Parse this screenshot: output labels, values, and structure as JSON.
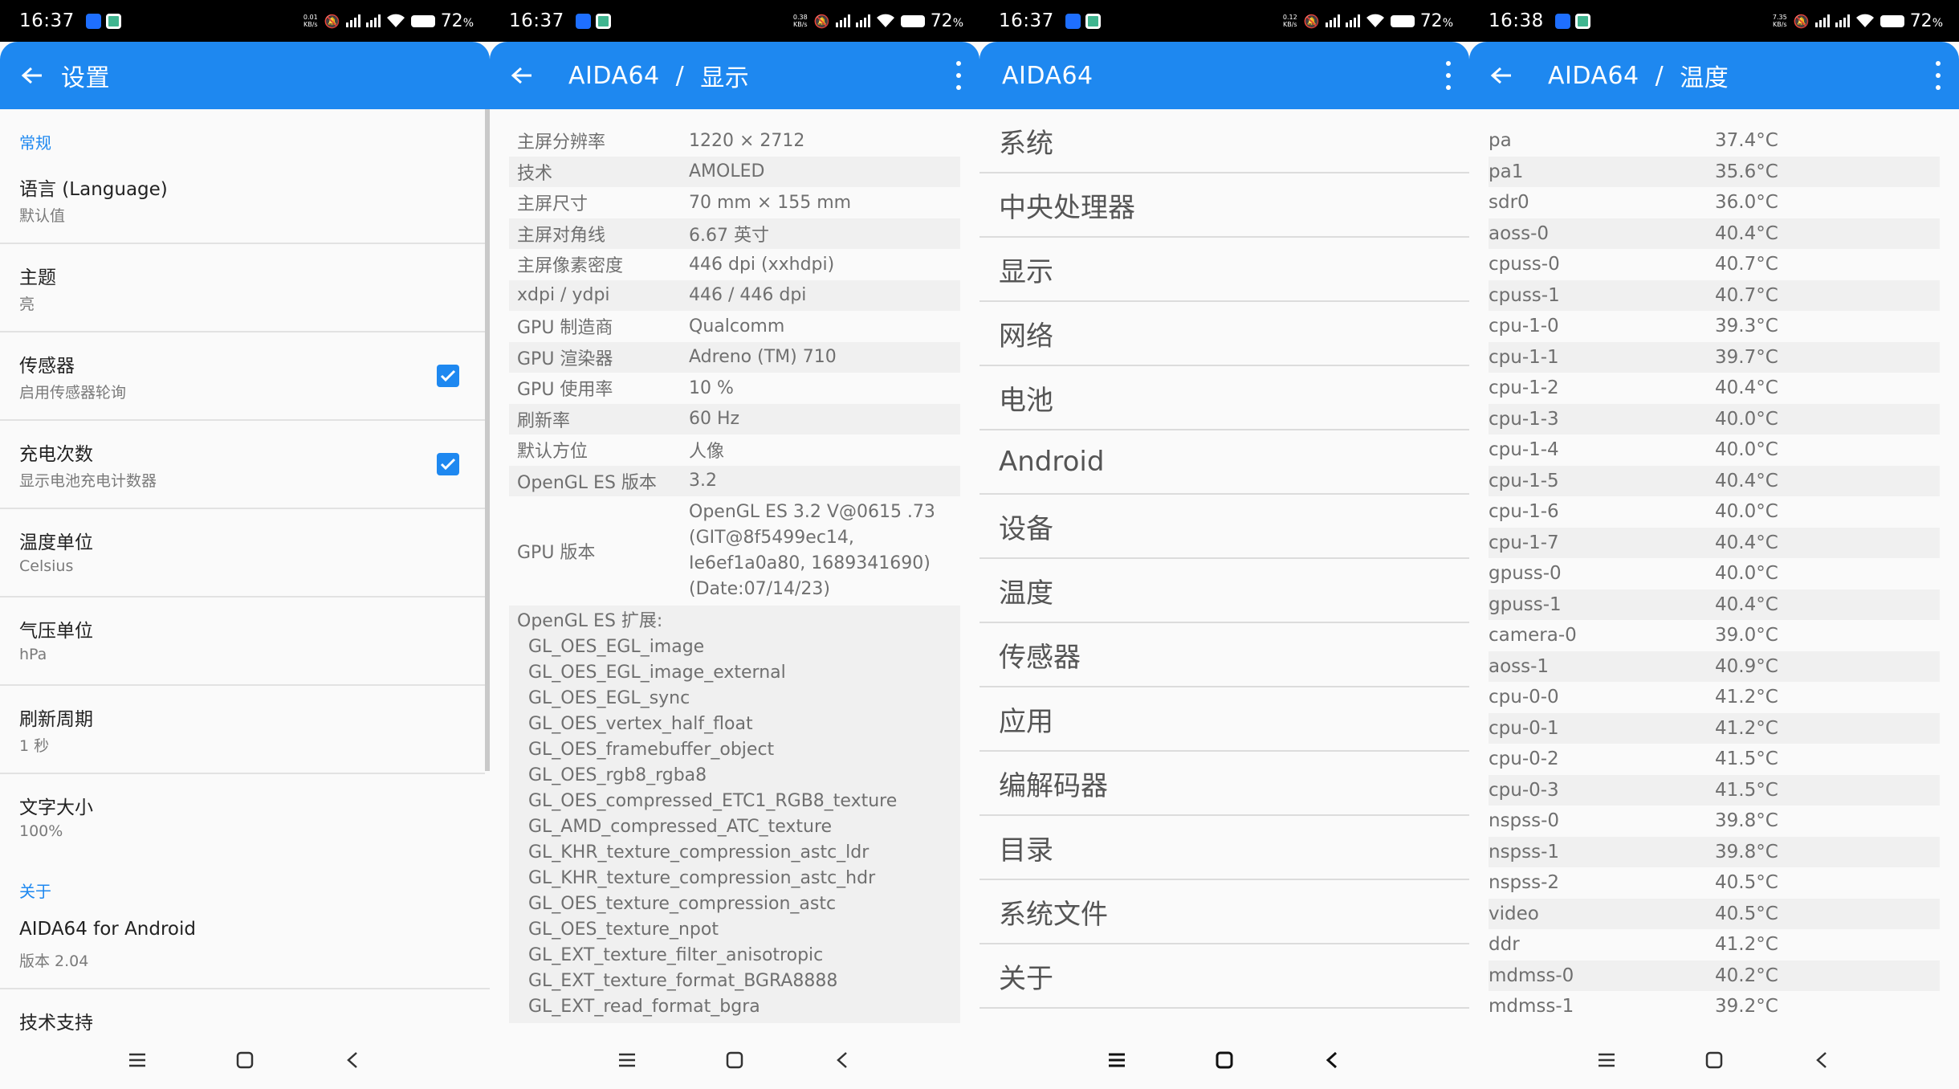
{
  "status_bars": [
    {
      "time": "16:37",
      "speed_top": "0.01",
      "speed_unit": "KB/s",
      "battery": "72"
    },
    {
      "time": "16:37",
      "speed_top": "0.38",
      "speed_unit": "KB/s",
      "battery": "72"
    },
    {
      "time": "16:37",
      "speed_top": "0.12",
      "speed_unit": "KB/s",
      "battery": "72"
    },
    {
      "time": "16:38",
      "speed_top": "7.35",
      "speed_unit": "KB/s",
      "battery": "72"
    }
  ],
  "battery_suffix": "%",
  "settings": {
    "title": "设置",
    "section_general": "常规",
    "items": [
      {
        "title": "语言 (Language)",
        "subtitle": "默认值"
      },
      {
        "title": "主题",
        "subtitle": "亮"
      },
      {
        "title": "传感器",
        "subtitle": "启用传感器轮询",
        "checked": true
      },
      {
        "title": "充电次数",
        "subtitle": "显示电池充电计数器",
        "checked": true
      },
      {
        "title": "温度单位",
        "subtitle": "Celsius"
      },
      {
        "title": "气压单位",
        "subtitle": "hPa"
      },
      {
        "title": "刷新周期",
        "subtitle": "1 秒"
      },
      {
        "title": "文字大小",
        "subtitle": "100%"
      }
    ],
    "section_about": "关于",
    "about_items": [
      {
        "title": "AIDA64 for Android",
        "subtitle": "版本 2.04"
      },
      {
        "title": "技术支持",
        "subtitle": ""
      }
    ]
  },
  "display": {
    "app_name": "AIDA64",
    "separator": "/",
    "page": "显示",
    "rows": [
      {
        "k": "主屏分辨率",
        "v": "1220 × 2712"
      },
      {
        "k": "技术",
        "v": "AMOLED"
      },
      {
        "k": "主屏尺寸",
        "v": "70 mm × 155 mm"
      },
      {
        "k": "主屏对角线",
        "v": "6.67 英寸"
      },
      {
        "k": "主屏像素密度",
        "v": "446 dpi (xxhdpi)"
      },
      {
        "k": "xdpi / ydpi",
        "v": "446 / 446 dpi"
      },
      {
        "k": "GPU 制造商",
        "v": "Qualcomm"
      },
      {
        "k": "GPU 渲染器",
        "v": "Adreno (TM) 710"
      },
      {
        "k": "GPU 使用率",
        "v": "10 %"
      },
      {
        "k": "刷新率",
        "v": "60 Hz"
      },
      {
        "k": "默认方位",
        "v": "人像"
      },
      {
        "k": "OpenGL ES 版本",
        "v": "3.2"
      }
    ],
    "gpu_version_label": "GPU 版本",
    "gpu_version_value": "OpenGL ES 3.2 V@0615 .73 (GIT@8f5499ec14, Ie6ef1a0a80, 1689341690) (Date:07/14/23)",
    "ext_label": "OpenGL ES 扩展:",
    "extensions": [
      "GL_OES_EGL_image",
      "GL_OES_EGL_image_external",
      "GL_OES_EGL_sync",
      "GL_OES_vertex_half_float",
      "GL_OES_framebuffer_object",
      "GL_OES_rgb8_rgba8",
      "GL_OES_compressed_ETC1_RGB8_texture",
      "GL_AMD_compressed_ATC_texture",
      "GL_KHR_texture_compression_astc_ldr",
      "GL_KHR_texture_compression_astc_hdr",
      "GL_OES_texture_compression_astc",
      "GL_OES_texture_npot",
      "GL_EXT_texture_filter_anisotropic",
      "GL_EXT_texture_format_BGRA8888",
      "GL_EXT_read_format_bgra"
    ]
  },
  "main_menu": {
    "title": "AIDA64",
    "items": [
      "系统",
      "中央处理器",
      "显示",
      "网络",
      "电池",
      "Android",
      "设备",
      "温度",
      "传感器",
      "应用",
      "编解码器",
      "目录",
      "系统文件",
      "关于"
    ]
  },
  "temperature": {
    "app_name": "AIDA64",
    "separator": "/",
    "page": "温度",
    "rows": [
      {
        "k": "pa",
        "v": "37.4°C"
      },
      {
        "k": "pa1",
        "v": "35.6°C"
      },
      {
        "k": "sdr0",
        "v": "36.0°C"
      },
      {
        "k": "aoss-0",
        "v": "40.4°C"
      },
      {
        "k": "cpuss-0",
        "v": "40.7°C"
      },
      {
        "k": "cpuss-1",
        "v": "40.7°C"
      },
      {
        "k": "cpu-1-0",
        "v": "39.3°C"
      },
      {
        "k": "cpu-1-1",
        "v": "39.7°C"
      },
      {
        "k": "cpu-1-2",
        "v": "40.4°C"
      },
      {
        "k": "cpu-1-3",
        "v": "40.0°C"
      },
      {
        "k": "cpu-1-4",
        "v": "40.0°C"
      },
      {
        "k": "cpu-1-5",
        "v": "40.4°C"
      },
      {
        "k": "cpu-1-6",
        "v": "40.0°C"
      },
      {
        "k": "cpu-1-7",
        "v": "40.4°C"
      },
      {
        "k": "gpuss-0",
        "v": "40.0°C"
      },
      {
        "k": "gpuss-1",
        "v": "40.4°C"
      },
      {
        "k": "camera-0",
        "v": "39.0°C"
      },
      {
        "k": "aoss-1",
        "v": "40.9°C"
      },
      {
        "k": "cpu-0-0",
        "v": "41.2°C"
      },
      {
        "k": "cpu-0-1",
        "v": "41.2°C"
      },
      {
        "k": "cpu-0-2",
        "v": "41.5°C"
      },
      {
        "k": "cpu-0-3",
        "v": "41.5°C"
      },
      {
        "k": "nspss-0",
        "v": "39.8°C"
      },
      {
        "k": "nspss-1",
        "v": "39.8°C"
      },
      {
        "k": "nspss-2",
        "v": "40.5°C"
      },
      {
        "k": "video",
        "v": "40.5°C"
      },
      {
        "k": "ddr",
        "v": "41.2°C"
      },
      {
        "k": "mdmss-0",
        "v": "40.2°C"
      },
      {
        "k": "mdmss-1",
        "v": "39.2°C"
      }
    ]
  },
  "colors": {
    "accent": "#1e88f0",
    "status_bar": "#000000",
    "background": "#fafafa"
  },
  "icons": {
    "back": "arrow-left-icon",
    "menu": "more-vert-icon",
    "check": "check-icon",
    "nav_menu": "hamburger-icon",
    "nav_home": "square-icon",
    "nav_back": "chevron-left-icon"
  }
}
